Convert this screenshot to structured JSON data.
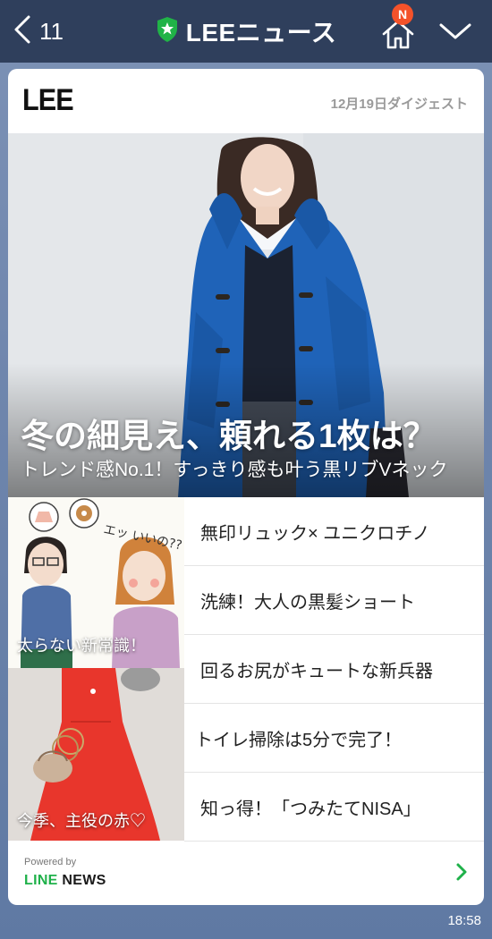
{
  "header": {
    "back_count": "11",
    "title": "LEEニュース",
    "home_badge": "N"
  },
  "card": {
    "brand": "LEE",
    "digest_date": "12月19日ダイジェスト",
    "hero": {
      "title": "冬の細見え、頼れる1枚は？",
      "subtitle": "トレンド感No.1！すっきり感も叶う黒リブVネック"
    },
    "thumbnails": [
      {
        "caption": "太らない新常識！",
        "illustration_text": "エッ いいの??"
      },
      {
        "caption": "今季、主役の赤♡"
      }
    ],
    "headlines": [
      "無印リュック× ユニクロチノ",
      "洗練！大人の黒髪ショート",
      "回るお尻がキュートな新兵器",
      "トイレ掃除は5分で完了！",
      "知っ得！「つみたてNISA」"
    ]
  },
  "footer": {
    "powered_by": "Powered by",
    "brand_line": "LINE",
    "brand_news": "NEWS"
  },
  "status": {
    "time": "18:58"
  },
  "colors": {
    "topbar": "#2f3f5c",
    "badge": "#f4522a",
    "line_green": "#1fb14a",
    "accent_blue": "#1f63b8"
  }
}
